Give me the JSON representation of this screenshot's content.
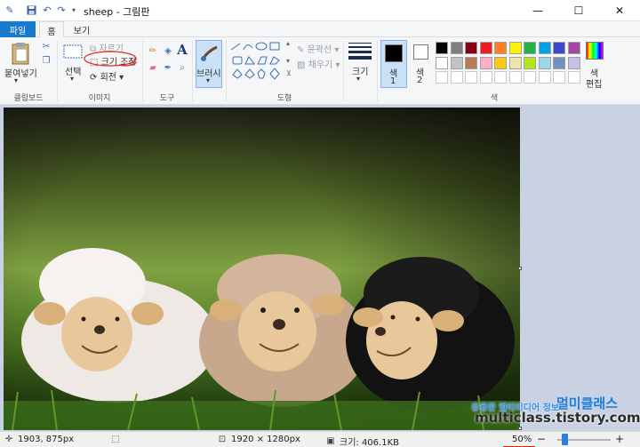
{
  "window": {
    "title": "sheep - 그림판",
    "minimize": "—",
    "maximize": "☐",
    "close": "✕"
  },
  "quick_access": [
    "paint-app-icon",
    "save-icon",
    "undo-icon",
    "redo-icon",
    "customize-dropdown"
  ],
  "tabs": {
    "file": "파일",
    "home": "홈",
    "view": "보기"
  },
  "ribbon": {
    "clipboard": {
      "group": "클립보드",
      "paste": "붙여넣기"
    },
    "image": {
      "group": "이미지",
      "select": "선택",
      "crop": "자르기",
      "resize": "크기 조정",
      "rotate": "회전"
    },
    "tools": {
      "group": "도구",
      "text_glyph": "A"
    },
    "brushes": {
      "label": "브러시"
    },
    "shapes": {
      "group": "도형",
      "outline": "윤곽선",
      "fill": "채우기"
    },
    "size": {
      "label": "크기"
    },
    "color1": {
      "label": "색\n1",
      "line1": "색",
      "line2": "1"
    },
    "color2": {
      "line1": "색",
      "line2": "2"
    },
    "colors": {
      "group": "색",
      "edit_line1": "색",
      "edit_line2": "편집",
      "row1": [
        "#000000",
        "#7f7f7f",
        "#880015",
        "#ed1c24",
        "#ff7f27",
        "#fff200",
        "#22b14c",
        "#00a2e8",
        "#3f48cc",
        "#a349a4"
      ],
      "row2": [
        "#ffffff",
        "#c3c3c3",
        "#b97a57",
        "#ffaec9",
        "#ffc90e",
        "#efe4b0",
        "#b5e61d",
        "#99d9ea",
        "#7092be",
        "#c8bfe7"
      ]
    }
  },
  "status": {
    "cursor_pos": "1903, 875px",
    "image_size": "1920 × 1280px",
    "file_size": "크기: 406.1KB",
    "zoom": "50%",
    "zoom_out": "−",
    "zoom_in": "+"
  },
  "watermark": {
    "line1": "유용한 멀티미디어 정보",
    "brand": "멀미클래스",
    "url": "multiclass.tistory.com"
  }
}
